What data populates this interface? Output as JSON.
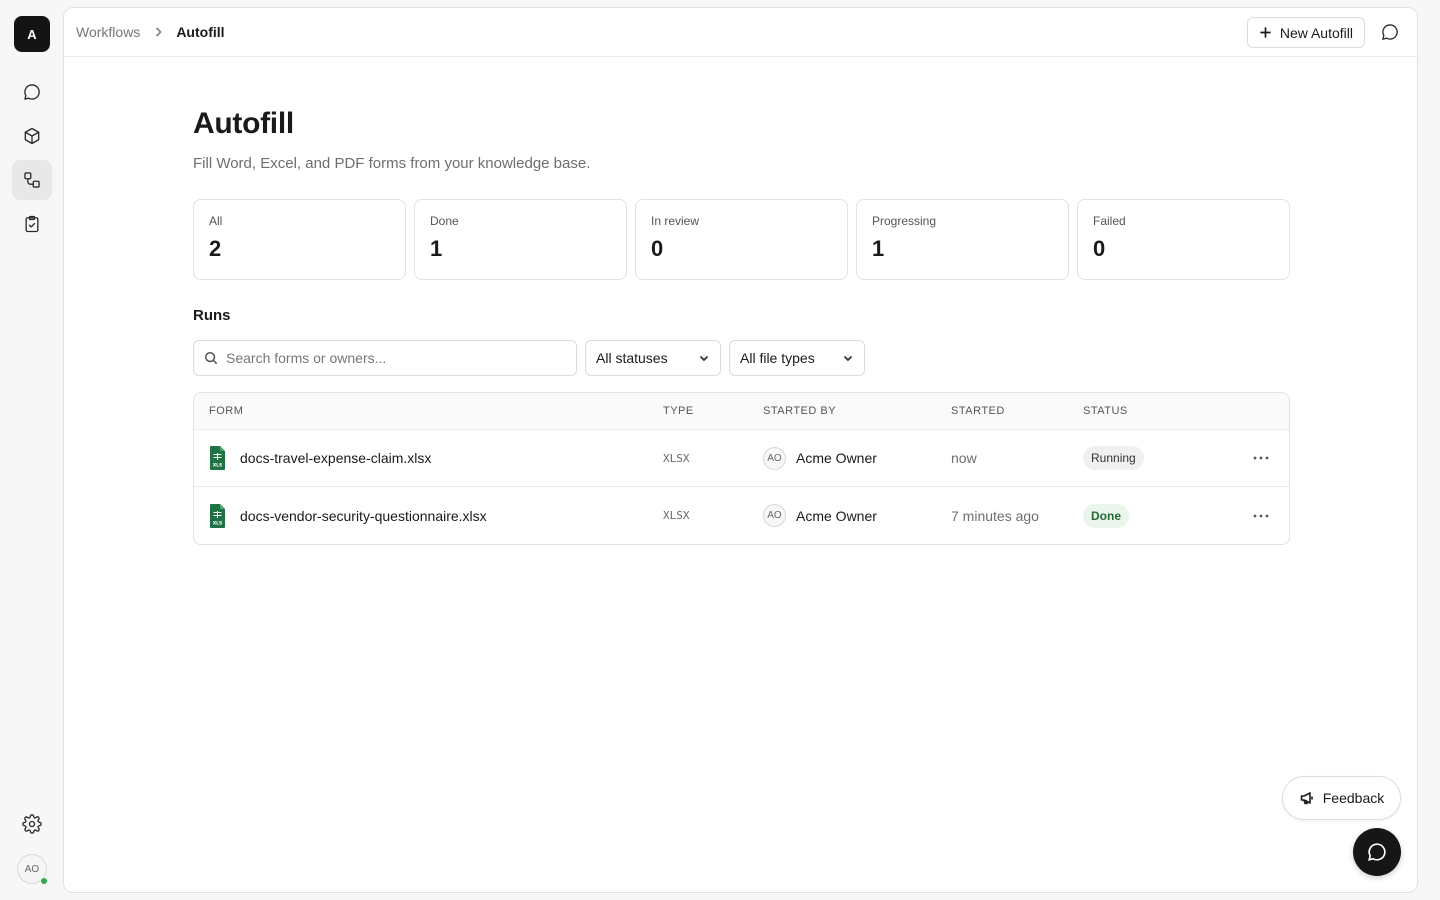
{
  "workspace": {
    "initial": "A"
  },
  "sidebar": {
    "items": [
      {
        "icon": "chat-bubble-icon"
      },
      {
        "icon": "cube-icon"
      },
      {
        "icon": "workflow-icon",
        "active": true
      },
      {
        "icon": "clipboard-check-icon"
      }
    ],
    "user_initials": "AO"
  },
  "breadcrumb": {
    "parent": "Workflows",
    "current": "Autofill"
  },
  "toolbar": {
    "new_label": "New Autofill"
  },
  "page": {
    "title": "Autofill",
    "subtitle": "Fill Word, Excel, and PDF forms from your knowledge base."
  },
  "stats": [
    {
      "label": "All",
      "value": "2"
    },
    {
      "label": "Done",
      "value": "1"
    },
    {
      "label": "In review",
      "value": "0"
    },
    {
      "label": "Progressing",
      "value": "1"
    },
    {
      "label": "Failed",
      "value": "0"
    }
  ],
  "runs": {
    "title": "Runs",
    "search_placeholder": "Search forms or owners...",
    "status_filter": "All statuses",
    "type_filter": "All file types",
    "columns": [
      "FORM",
      "TYPE",
      "STARTED BY",
      "STARTED",
      "STATUS"
    ],
    "rows": [
      {
        "form": "docs-travel-expense-claim.xlsx",
        "type": "XLSX",
        "owner_initials": "AO",
        "owner": "Acme Owner",
        "started": "now",
        "status": "Running"
      },
      {
        "form": "docs-vendor-security-questionnaire.xlsx",
        "type": "XLSX",
        "owner_initials": "AO",
        "owner": "Acme Owner",
        "started": "7 minutes ago",
        "status": "Done"
      }
    ]
  },
  "feedback_label": "Feedback",
  "colors": {
    "excel_green": "#1f7244",
    "done_green": "#236b35",
    "online": "#2fa84f"
  }
}
